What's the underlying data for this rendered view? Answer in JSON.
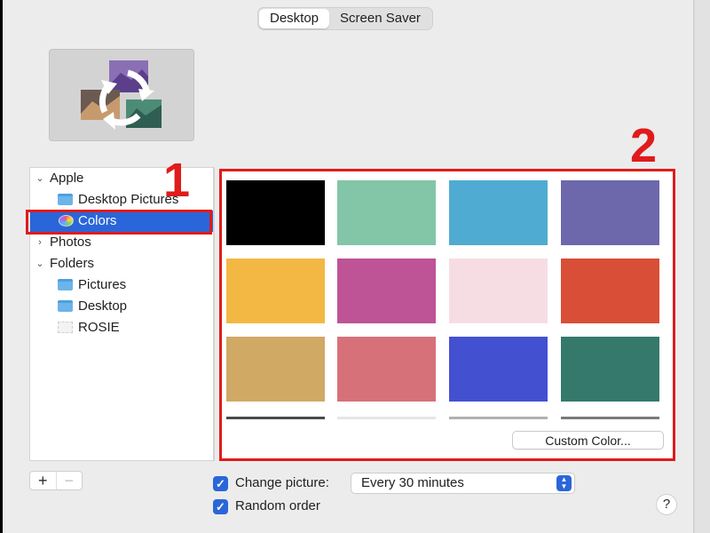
{
  "tabs": [
    {
      "label": "Desktop",
      "active": true
    },
    {
      "label": "Screen Saver",
      "active": false
    }
  ],
  "sidebar": {
    "apple_label": "Apple",
    "desktop_pictures_label": "Desktop Pictures",
    "colors_label": "Colors",
    "photos_label": "Photos",
    "folders_label": "Folders",
    "pictures_label": "Pictures",
    "desktop_label": "Desktop",
    "rosie_label": "ROSIE"
  },
  "annotations": {
    "step1": "1",
    "step2": "2",
    "highlight_color": "#e01b1b"
  },
  "swatches": [
    "#000000",
    "#82c5a7",
    "#4fabd2",
    "#6d67ac",
    "#f3b843",
    "#be5395",
    "#f6dde4",
    "#d94e36",
    "#d0a965",
    "#d6717a",
    "#4351d1",
    "#34796b"
  ],
  "partial_swatches": [
    "#4a4a4a",
    "#e6e6e6",
    "#b0b0b0",
    "#7a7a7a"
  ],
  "custom_color_label": "Custom Color...",
  "add_remove": {
    "add": "+",
    "remove": "−"
  },
  "change_picture": {
    "label": "Change picture:",
    "checked": true
  },
  "interval_value": "Every 30 minutes",
  "random_order": {
    "label": "Random order",
    "checked": true
  },
  "help_label": "?",
  "accent_color": "#2a66d9"
}
